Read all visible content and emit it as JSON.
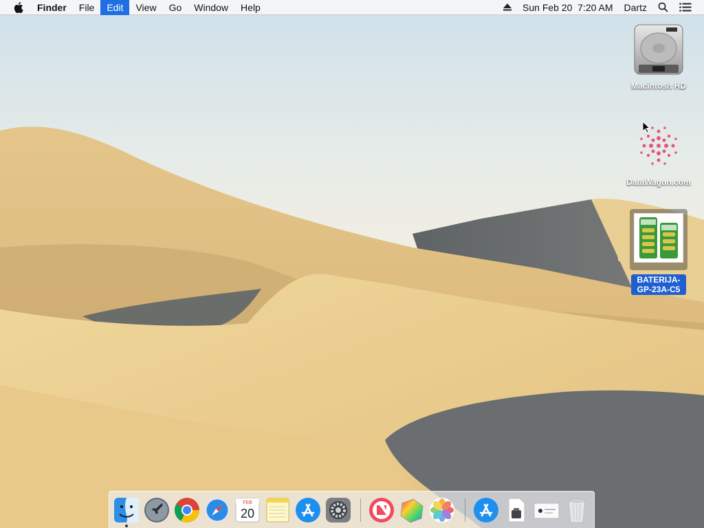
{
  "menubar": {
    "app_name": "Finder",
    "menus": [
      "File",
      "Edit",
      "View",
      "Go",
      "Window",
      "Help"
    ],
    "active_menu": "Edit",
    "clock": "Sun Feb 20  7:20 AM",
    "user": "Dartz"
  },
  "desktop_icons": [
    {
      "label": "Macintosh HD",
      "icon": "hard-drive-icon"
    },
    {
      "label": "DataWagon.com",
      "icon": "pink-dots-image-icon"
    },
    {
      "label_line1": "BATERIJA-",
      "label_line2": "GP-23A-C5",
      "icon": "battery-pack-image-icon",
      "selected": true
    }
  ],
  "dock": {
    "apps": [
      "finder-icon",
      "launchpad-icon",
      "chrome-icon",
      "safari-icon",
      "calendar-icon",
      "notes-icon",
      "app-store-icon",
      "system-preferences-icon",
      "news-icon",
      "color-picker-icon",
      "photos-icon"
    ],
    "stacks": [
      "applications-folder-icon",
      "document-icon",
      "image-file-icon",
      "trash-icon"
    ],
    "calendar_month": "FEB",
    "calendar_day": "20"
  },
  "colors": {
    "accent": "#1f6fe3",
    "sand": "#e6c889",
    "shadow": "#6f7376"
  }
}
